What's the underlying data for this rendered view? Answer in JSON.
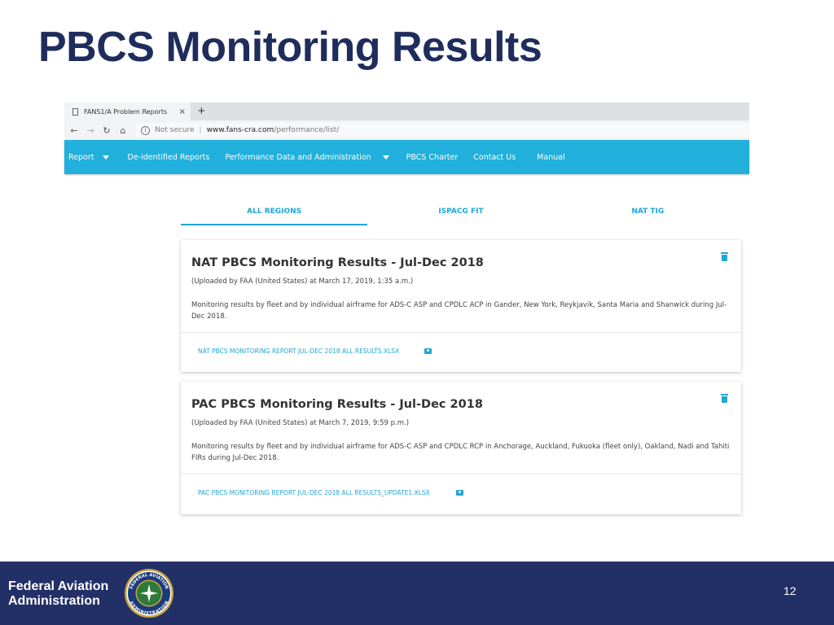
{
  "slide": {
    "title": "PBCS Monitoring Results",
    "page_number": "12"
  },
  "browser": {
    "tab_title": "FANS1/A Problem Reports",
    "tab_close": "×",
    "new_tab": "+",
    "not_secure": "Not secure",
    "separator": "|",
    "url_host": "www.fans-cra.com",
    "url_path": "/performance/list/"
  },
  "nav": {
    "items": [
      {
        "label": "Report"
      },
      {
        "label": "De-identified Reports"
      },
      {
        "label": "Performance Data and Administration"
      },
      {
        "label": "PBCS Charter"
      },
      {
        "label": "Contact Us"
      },
      {
        "label": "Manual"
      }
    ]
  },
  "regions": {
    "tabs": [
      {
        "label": "ALL REGIONS",
        "active": true
      },
      {
        "label": "ISPACG FIT",
        "active": false
      },
      {
        "label": "NAT TIG",
        "active": false
      }
    ]
  },
  "cards": [
    {
      "title": "NAT PBCS Monitoring Results - Jul-Dec 2018",
      "uploaded": "(Uploaded by FAA (United States) at March 17, 2019, 1:35 a.m.)",
      "description": "Monitoring results by fleet and by individual airframe for ADS-C ASP and CPDLC ACP in Gander, New York, Reykjavik, Santa Maria and Shanwick during Jul-Dec 2018.",
      "file": "NAT PBCS MONITORING REPORT JUL-DEC 2018 ALL RESULTS.XLSX"
    },
    {
      "title": "PAC PBCS Monitoring Results - Jul-Dec 2018",
      "uploaded": "(Uploaded by FAA (United States) at March 7, 2019, 9:59 p.m.)",
      "description": "Monitoring results by fleet and by individual airframe for ADS-C ASP and CPDLC RCP in Anchorage, Auckland, Fukuoka (fleet only), Oakland, Nadi and Tahiti FIRs during Jul-Dec 2018.",
      "file": "PAC PBCS MONITORING REPORT JUL-DEC 2018 ALL RESULTS_UPDATE1.XLSX"
    }
  ],
  "footer": {
    "org_line1": "Federal Aviation",
    "org_line2": "Administration",
    "seal_top": "FEDERAL AVIATION",
    "seal_bottom": "ADMINISTRATION"
  },
  "colors": {
    "title": "#1f2d5c",
    "nav_bg": "#21b0dc",
    "accent": "#21a6d6",
    "footer_bg": "#233067"
  },
  "icons": {
    "back": "arrow-left-icon",
    "forward": "arrow-right-icon",
    "reload": "reload-icon",
    "home": "home-icon",
    "delete": "trash-icon",
    "file_preview": "search-icon"
  }
}
